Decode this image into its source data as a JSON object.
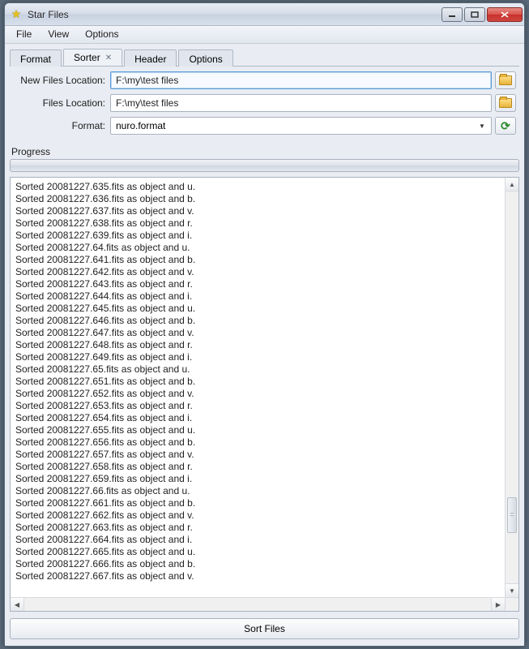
{
  "window": {
    "title": "Star Files"
  },
  "menubar": {
    "items": [
      "File",
      "View",
      "Options"
    ]
  },
  "tabs": [
    {
      "label": "Format",
      "active": false,
      "closable": false
    },
    {
      "label": "Sorter",
      "active": true,
      "closable": true
    },
    {
      "label": "Header",
      "active": false,
      "closable": false
    },
    {
      "label": "Options",
      "active": false,
      "closable": false
    }
  ],
  "form": {
    "new_files_location": {
      "label": "New Files Location:",
      "value": "F:\\my\\test files"
    },
    "files_location": {
      "label": "Files Location:",
      "value": "F:\\my\\test files"
    },
    "format": {
      "label": "Format:",
      "value": "nuro.format"
    }
  },
  "progress": {
    "label": "Progress"
  },
  "log": {
    "lines": [
      "Sorted 20081227.635.fits as object and u.",
      "Sorted 20081227.636.fits as object and b.",
      "Sorted 20081227.637.fits as object and v.",
      "Sorted 20081227.638.fits as object and r.",
      "Sorted 20081227.639.fits as object and i.",
      "Sorted 20081227.64.fits as object and u.",
      "Sorted 20081227.641.fits as object and b.",
      "Sorted 20081227.642.fits as object and v.",
      "Sorted 20081227.643.fits as object and r.",
      "Sorted 20081227.644.fits as object and i.",
      "Sorted 20081227.645.fits as object and u.",
      "Sorted 20081227.646.fits as object and b.",
      "Sorted 20081227.647.fits as object and v.",
      "Sorted 20081227.648.fits as object and r.",
      "Sorted 20081227.649.fits as object and i.",
      "Sorted 20081227.65.fits as object and u.",
      "Sorted 20081227.651.fits as object and b.",
      "Sorted 20081227.652.fits as object and v.",
      "Sorted 20081227.653.fits as object and r.",
      "Sorted 20081227.654.fits as object and i.",
      "Sorted 20081227.655.fits as object and u.",
      "Sorted 20081227.656.fits as object and b.",
      "Sorted 20081227.657.fits as object and v.",
      "Sorted 20081227.658.fits as object and r.",
      "Sorted 20081227.659.fits as object and i.",
      "Sorted 20081227.66.fits as object and u.",
      "Sorted 20081227.661.fits as object and b.",
      "Sorted 20081227.662.fits as object and v.",
      "Sorted 20081227.663.fits as object and r.",
      "Sorted 20081227.664.fits as object and i.",
      "Sorted 20081227.665.fits as object and u.",
      "Sorted 20081227.666.fits as object and b.",
      "Sorted 20081227.667.fits as object and v."
    ]
  },
  "buttons": {
    "sort_files": "Sort Files"
  }
}
